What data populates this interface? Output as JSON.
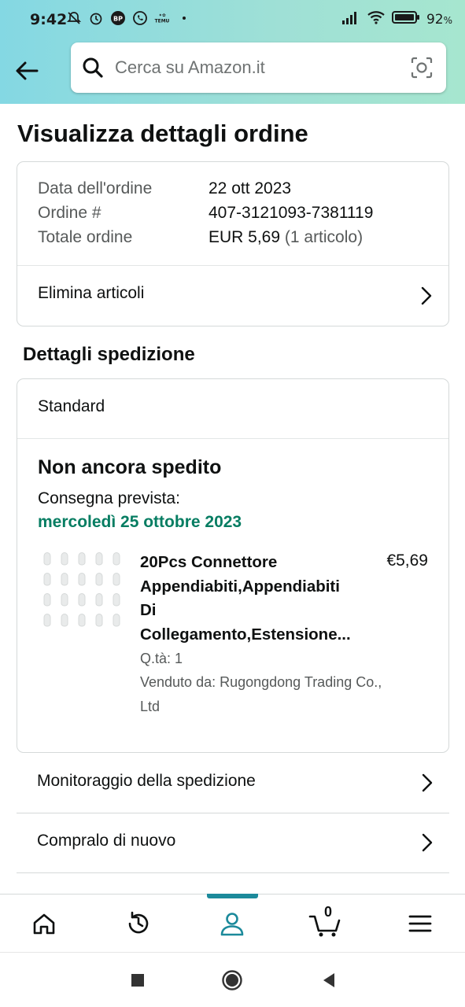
{
  "status_bar": {
    "time": "9:42",
    "battery_percent": "92",
    "battery_suffix": "%",
    "temu_label": "TEMU"
  },
  "header": {
    "search_placeholder": "Cerca su Amazon.it"
  },
  "page_title": "Visualizza dettagli ordine",
  "order_summary": {
    "rows": [
      {
        "label": "Data dell'ordine",
        "value": "22 ott 2023",
        "extra": ""
      },
      {
        "label": "Ordine #",
        "value": "407-3121093-7381119",
        "extra": ""
      },
      {
        "label": "Totale ordine",
        "value": "EUR 5,69",
        "extra": " (1 articolo)"
      }
    ],
    "delete_items_label": "Elimina articoli"
  },
  "shipping": {
    "section_title": "Dettagli spedizione",
    "method": "Standard",
    "status": "Non ancora spedito",
    "delivery_label": "Consegna prevista:",
    "delivery_date": "mercoledì 25 ottobre 2023",
    "delivery_date_color": "#067d62"
  },
  "item": {
    "title_lines": [
      "20Pcs Connettore",
      "Appendiabiti,Appendiabiti",
      "Di",
      "Collegamento,Estensione..."
    ],
    "price": "€5,69",
    "quantity": "Q.tà: 1",
    "seller_lines": [
      "Venduto da: Rugongdong Trading Co.,",
      "Ltd"
    ]
  },
  "actions": {
    "track_label": "Monitoraggio della spedizione",
    "buy_again_label": "Compralo di nuovo"
  },
  "bottom_nav": {
    "items": [
      {
        "icon": "home-icon"
      },
      {
        "icon": "history-icon"
      },
      {
        "icon": "account-icon",
        "active": true
      },
      {
        "icon": "cart-icon"
      },
      {
        "icon": "menu-icon"
      }
    ],
    "cart_count": "0",
    "active_color": "#1c8a9b"
  },
  "colors": {
    "header_gradient_start": "#84d8e3",
    "header_gradient_end": "#a6e6cf",
    "text_primary": "#0f1111",
    "text_secondary": "#565959"
  }
}
